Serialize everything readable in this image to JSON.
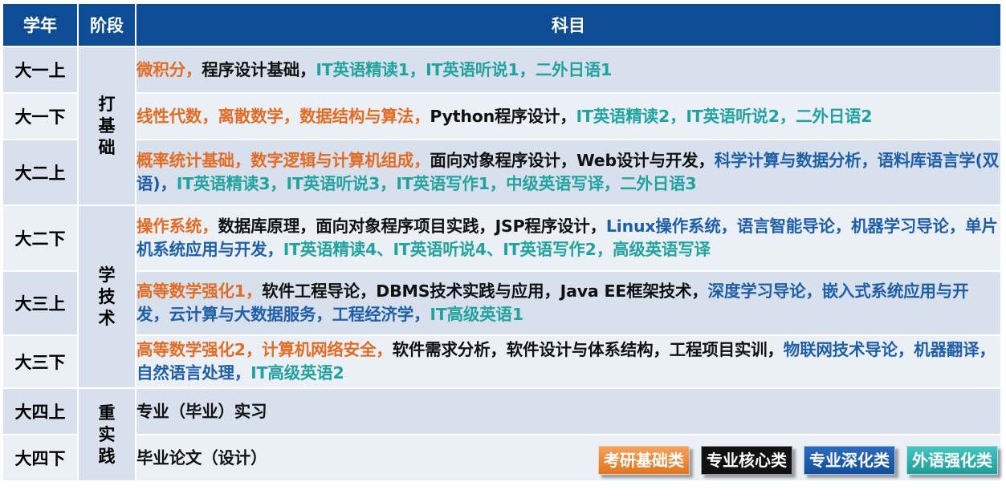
{
  "header": {
    "year": "学年",
    "stage": "阶段",
    "subjects": "科目"
  },
  "stages": [
    {
      "chars": [
        "打",
        "基",
        "础"
      ]
    },
    {
      "chars": [
        "学",
        "技",
        "术"
      ]
    },
    {
      "chars": [
        "重",
        "实",
        "践"
      ]
    }
  ],
  "rows": [
    {
      "year": "大一上",
      "segments": [
        {
          "text": "微积分，",
          "category": "orange"
        },
        {
          "text": "程序设计基础，",
          "category": "black"
        },
        {
          "text": "IT英语精读1，IT英语听说1，二外日语1",
          "category": "teal"
        }
      ]
    },
    {
      "year": "大一下",
      "segments": [
        {
          "text": "线性代数，离散数学，数据结构与算法，",
          "category": "orange"
        },
        {
          "text": "Python程序设计，",
          "category": "black"
        },
        {
          "text": "IT英语精读2，IT英语听说2，二外日语2",
          "category": "teal"
        }
      ]
    },
    {
      "year": "大二上",
      "segments": [
        {
          "text": "概率统计基础，数字逻辑与计算机组成，",
          "category": "orange"
        },
        {
          "text": "面向对象程序设计，Web设计与开发，",
          "category": "black"
        },
        {
          "text": "科学计算与数据分析，语料库语言学(双语)，",
          "category": "blue"
        },
        {
          "text": "IT英语精读3，IT英语听说3，IT英语写作1，中级英语写译，二外日语3",
          "category": "teal"
        }
      ]
    },
    {
      "year": "大二下",
      "segments": [
        {
          "text": "操作系统，",
          "category": "orange"
        },
        {
          "text": "数据库原理，面向对象程序项目实践，JSP程序设计，",
          "category": "black"
        },
        {
          "text": "Linux操作系统，语言智能导论，机器学习导论，单片机系统应用与开发，",
          "category": "blue"
        },
        {
          "text": "IT英语精读4、IT英语听说4、IT英语写作2，高级英语写译",
          "category": "teal"
        }
      ]
    },
    {
      "year": "大三上",
      "segments": [
        {
          "text": "高等数学强化1，",
          "category": "orange"
        },
        {
          "text": "软件工程导论，DBMS技术实践与应用，Java EE框架技术，",
          "category": "black"
        },
        {
          "text": "深度学习导论，嵌入式系统应用与开发，云计算与大数据服务，工程经济学，",
          "category": "blue"
        },
        {
          "text": "IT高级英语1",
          "category": "teal"
        }
      ]
    },
    {
      "year": "大三下",
      "segments": [
        {
          "text": "高等数学强化2，计算机网络安全，",
          "category": "orange"
        },
        {
          "text": "软件需求分析，软件设计与体系结构，工程项目实训，",
          "category": "black"
        },
        {
          "text": "物联网技术导论，机器翻译，自然语言处理，",
          "category": "blue"
        },
        {
          "text": "IT高级英语2",
          "category": "teal"
        }
      ]
    },
    {
      "year": "大四上",
      "segments": [
        {
          "text": "专业（毕业）实习",
          "category": "black"
        }
      ]
    },
    {
      "year": "大四下",
      "segments": [
        {
          "text": "毕业论文（设计）",
          "category": "black"
        }
      ]
    }
  ],
  "legend": [
    {
      "label": "考研基础类",
      "category": "orange"
    },
    {
      "label": "专业核心类",
      "category": "black"
    },
    {
      "label": "专业深化类",
      "category": "blue"
    },
    {
      "label": "外语强化类",
      "category": "teal"
    }
  ],
  "colors": {
    "header_bg": "#0f4c96",
    "row_bg_dark": "#d7e0ec",
    "row_bg_light": "#ebeff6",
    "orange": "#e36c24",
    "black": "#111111",
    "blue": "#1f5fa8",
    "teal": "#23a3a0"
  }
}
